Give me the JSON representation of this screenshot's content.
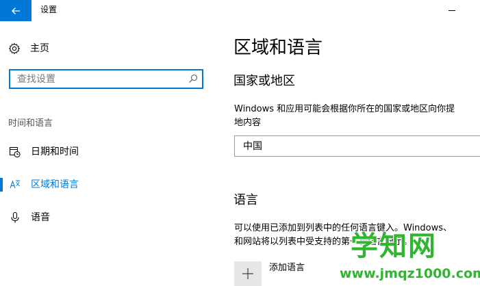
{
  "window": {
    "title": "设置",
    "accent_color": "#0078d7"
  },
  "sidebar": {
    "home_label": "主页",
    "search_placeholder": "查找设置",
    "section_header": "时间和语言",
    "items": [
      {
        "label": "日期和时间",
        "icon": "calendar-clock-icon",
        "selected": false
      },
      {
        "label": "区域和语言",
        "icon": "language-icon",
        "selected": true
      },
      {
        "label": "语音",
        "icon": "microphone-icon",
        "selected": false
      }
    ]
  },
  "main": {
    "title": "区域和语言",
    "country_section": {
      "title": "国家或地区",
      "description_line1": "Windows 和应用可能会根据你所在的国家或地区向你提",
      "description_line2": "地内容",
      "selected_country": "中国"
    },
    "language_section": {
      "title": "语言",
      "description_line1": "可以使用已添加到列表中的任何语言键入。Windows、",
      "description_line2": "和网站将以列表中受支持的第一种语言显示。",
      "add_language_label": "添加语言"
    }
  },
  "watermark": {
    "top": "学知网",
    "bottom": "www.jmqz1000.com",
    "color": "#2fb52f"
  }
}
